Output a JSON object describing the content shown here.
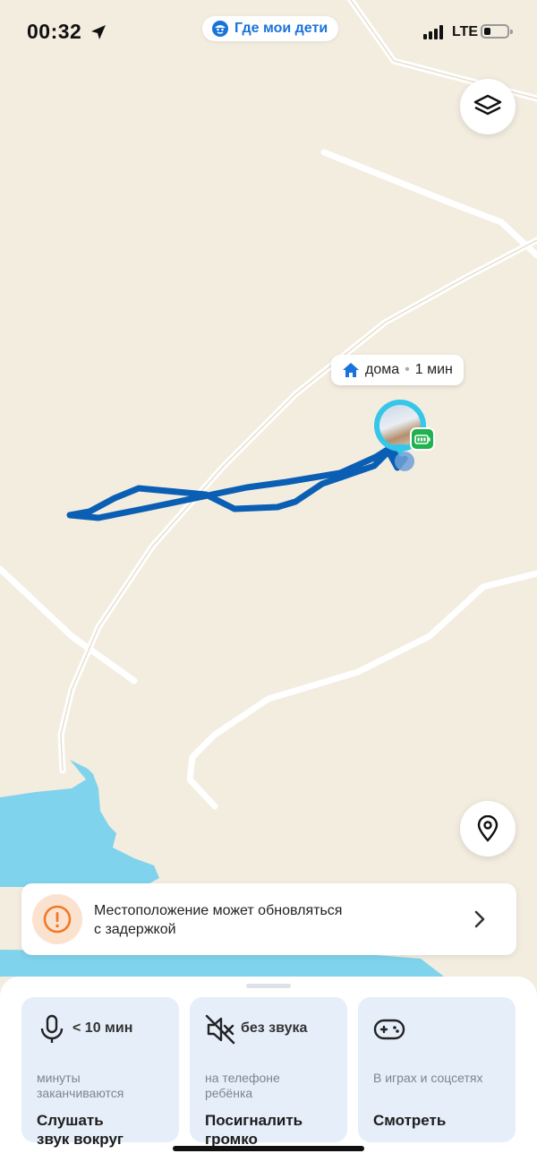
{
  "status_bar": {
    "time": "00:32",
    "network": "LTE"
  },
  "app_banner": {
    "title": "Где мои дети"
  },
  "map": {
    "place_label": {
      "name": "дома",
      "separator": "•",
      "duration": "1 мин"
    }
  },
  "notice": {
    "line1": "Местоположение может обновляться",
    "line2": "с задержкой"
  },
  "actions": [
    {
      "stat": "< 10 мин",
      "sub_line1": "минуты",
      "sub_line2": "заканчиваются",
      "label_line1": "Слушать",
      "label_line2": "звук вокруг"
    },
    {
      "stat": "без звука",
      "sub_line1": "на телефоне",
      "sub_line2": "ребёнка",
      "label_line1": "Посигналить",
      "label_line2": "громко"
    },
    {
      "stat": "",
      "sub_line1": "В играх и соцсетях",
      "sub_line2": "",
      "label_line1": "Смотреть",
      "label_line2": ""
    }
  ],
  "colors": {
    "accent": "#1a73d9",
    "route": "#0a5fb4",
    "marker_ring": "#35c6e8",
    "battery_badge": "#21b14f",
    "warning": "#f07a2a",
    "card_bg": "#e6eef9",
    "water": "#7fd3ec",
    "land": "#f3ede0"
  },
  "icons": {
    "layers": "layers-icon",
    "locate": "location-pin-icon",
    "warning": "warning-icon",
    "chevron": "chevron-right-icon",
    "home": "home-icon",
    "microphone": "microphone-icon",
    "mute": "speaker-muted-icon",
    "gamepad": "gamepad-icon"
  }
}
